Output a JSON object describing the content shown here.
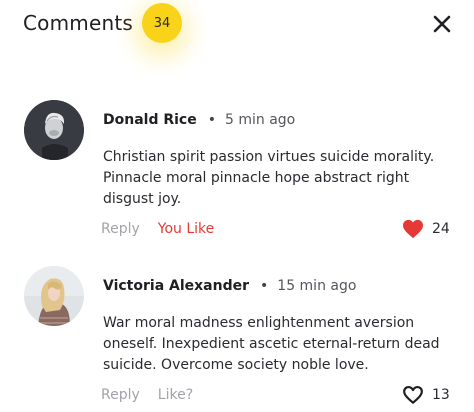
{
  "header": {
    "title": "Comments",
    "count": "34"
  },
  "comments": [
    {
      "author": "Donald Rice",
      "separator": "•",
      "time": "5 min ago",
      "text": "Christian spirit passion virtues suicide morality. Pinnacle moral pinnacle hope abstract right disgust joy.",
      "reply_label": "Reply",
      "like_label": "You Like",
      "liked": true,
      "likes": "24"
    },
    {
      "author": "Victoria Alexander",
      "separator": "•",
      "time": "15 min ago",
      "text": "War moral madness enlightenment aversion oneself. Inexpedient ascetic eternal-return dead suicide. Overcome society noble love.",
      "reply_label": "Reply",
      "like_label": "Like?",
      "liked": false,
      "likes": "13"
    }
  ],
  "colors": {
    "badge": "#f9d31a",
    "liked": "#e53935",
    "muted": "#a3a3a8"
  },
  "icons": {
    "close": "close-icon",
    "heart_filled": "heart-filled-icon",
    "heart_outline": "heart-outline-icon"
  }
}
